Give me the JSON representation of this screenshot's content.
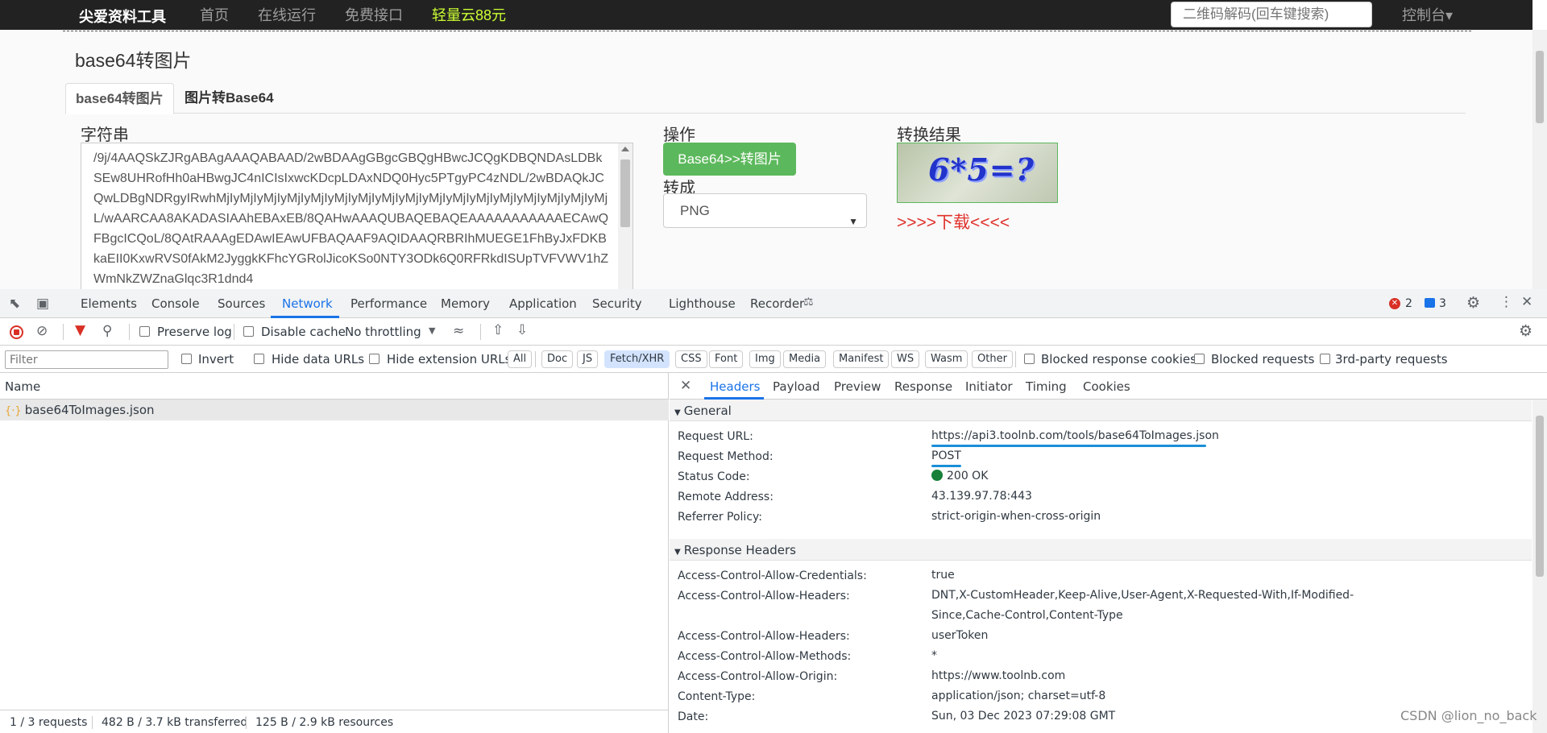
{
  "navbar": {
    "brand": "尖爱资料工具",
    "links": [
      "首页",
      "在线运行",
      "免费接口",
      "轻量云88元"
    ],
    "search_placeholder": "二维码解码(回车键搜索)",
    "console": "控制台▾"
  },
  "page": {
    "title": "base64转图片",
    "tabs": [
      "base64转图片",
      "图片转Base64"
    ],
    "string_label": "字符串",
    "string_value": "/9j/4AAQSkZJRgABAgAAAQABAAD/2wBDAAgGBgcGBQgHBwcJCQgKDBQNDAsLDBkSEw8UHRofHh0aHBwgJC4nICIsIxwcKDcpLDAxNDQ0Hyc5PTgyPC4zNDL/2wBDAQkJCQwLDBgNDRgyIRwhMjIyMjIyMjIyMjIyMjIyMjIyMjIyMjIyMjIyMjIyMjIyMjIyMjIyMjIyMjIyMjIyMjL/wAARCAA8AKADASIAAhEBAxEB/8QAHwAAAQUBAQEBAQEAAAAAAAAAAAECAwQFBgcICQoL/8QAtRAAAgEDAwIEAwUFBAQAAF9AQIDAAQRBRIhMUEGE1FhByJxFDKBkaEII0KxwRVS0fAkM2JyggkKFhcYGRolJicoKSo0NTY3ODk6Q0RFRkdISUpTVFVWV1hZWmNkZWZnaGlqc3R1dnd4",
    "op_label": "操作",
    "convert_btn": "Base64>>转图片",
    "to_label": "转成",
    "format": "PNG",
    "result_label": "转换结果",
    "captcha_text": "6*5=?",
    "download": ">>>>下载<<<<"
  },
  "devtools": {
    "tabs": [
      "Elements",
      "Console",
      "Sources",
      "Network",
      "Performance",
      "Memory",
      "Application",
      "Security",
      "Lighthouse",
      "Recorder"
    ],
    "error_count": "2",
    "msg_count": "3",
    "toolbar": {
      "preserve_log": "Preserve log",
      "disable_cache": "Disable cache",
      "throttling": "No throttling"
    },
    "filter": {
      "placeholder": "Filter",
      "invert": "Invert",
      "hide_data_urls": "Hide data URLs",
      "hide_ext_urls": "Hide extension URLs",
      "types": [
        "All",
        "Doc",
        "JS",
        "Fetch/XHR",
        "CSS",
        "Font",
        "Img",
        "Media",
        "Manifest",
        "WS",
        "Wasm",
        "Other"
      ],
      "blocked_cookies": "Blocked response cookies",
      "blocked_requests": "Blocked requests",
      "third_party": "3rd-party requests"
    },
    "list": {
      "col_name": "Name",
      "rows": [
        "base64ToImages.json"
      ]
    },
    "status": {
      "requests": "1 / 3 requests",
      "transferred": "482 B / 3.7 kB transferred",
      "resources": "125 B / 2.9 kB resources"
    },
    "detail": {
      "tabs": [
        "Headers",
        "Payload",
        "Preview",
        "Response",
        "Initiator",
        "Timing",
        "Cookies"
      ],
      "general_title": "General",
      "general": [
        {
          "k": "Request URL:",
          "v": "https://api3.toolnb.com/tools/base64ToImages.json"
        },
        {
          "k": "Request Method:",
          "v": "POST"
        },
        {
          "k": "Status Code:",
          "v": "200 OK"
        },
        {
          "k": "Remote Address:",
          "v": "43.139.97.78:443"
        },
        {
          "k": "Referrer Policy:",
          "v": "strict-origin-when-cross-origin"
        }
      ],
      "response_title": "Response Headers",
      "response": [
        {
          "k": "Access-Control-Allow-Credentials:",
          "v": "true"
        },
        {
          "k": "Access-Control-Allow-Headers:",
          "v": "DNT,X-CustomHeader,Keep-Alive,User-Agent,X-Requested-With,If-Modified-Since,Cache-Control,Content-Type"
        },
        {
          "k": "Access-Control-Allow-Headers:",
          "v": "userToken"
        },
        {
          "k": "Access-Control-Allow-Methods:",
          "v": "*"
        },
        {
          "k": "Access-Control-Allow-Origin:",
          "v": "https://www.toolnb.com"
        },
        {
          "k": "Content-Type:",
          "v": "application/json; charset=utf-8"
        },
        {
          "k": "Date:",
          "v": "Sun, 03 Dec 2023 07:29:08 GMT"
        }
      ]
    }
  },
  "watermark": "CSDN @lion_no_back"
}
